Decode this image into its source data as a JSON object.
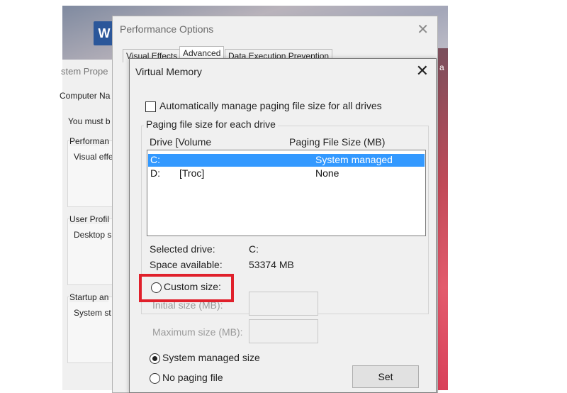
{
  "background": {
    "word_icon_letter": "W",
    "sysprop": {
      "title": "stem Prope",
      "tab": "Computer Na",
      "line1": "You must b",
      "group1_title": "Performan",
      "group1_text": "Visual effe",
      "group2_title": "User Profil",
      "group2_text": "Desktop s",
      "group3_title": "Startup an",
      "group3_text": "System st"
    },
    "side_text": "a"
  },
  "performance_options": {
    "title": "Performance Options",
    "tabs": [
      "Visual Effects",
      "Advanced",
      "Data Execution Prevention"
    ]
  },
  "virtual_memory": {
    "title": "Virtual Memory",
    "auto_manage_label": "Automatically manage paging file size for all drives",
    "auto_manage_checked": false,
    "group_title": "Paging file size for each drive",
    "columns": {
      "drive": "Drive  [Volume",
      "size": "Paging File Size (MB)"
    },
    "drives": [
      {
        "drive": "C:",
        "volume": "",
        "size": "System managed",
        "selected": true
      },
      {
        "drive": "D:",
        "volume": "[Troc]",
        "size": "None",
        "selected": false
      }
    ],
    "selected_drive_label": "Selected drive:",
    "selected_drive_value": "C:",
    "space_available_label": "Space available:",
    "space_available_value": "53374 MB",
    "custom_size_label": "Custom size:",
    "initial_size_label": "Initial size (MB):",
    "maximum_size_label": "Maximum size (MB):",
    "system_managed_label": "System managed size",
    "no_paging_label": "No paging file",
    "set_button": "Set",
    "selected_option": "system_managed"
  },
  "colors": {
    "selection": "#3399ff",
    "highlight_box": "#e0202b"
  }
}
